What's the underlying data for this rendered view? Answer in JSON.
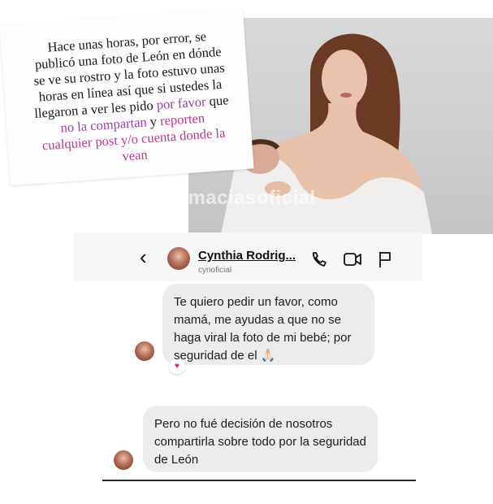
{
  "story": {
    "note_line1": "Hace unas horas, por error, se",
    "note_line2": "publicó una foto de León en dónde",
    "note_line3": "se ve su rostro y la foto estuvo unas",
    "note_line4": "horas en línea así que si ustedes la",
    "note_line5a": "llegaron a ver les pido ",
    "note_line5b": "por favor",
    "note_line5c": " que",
    "note_line6a": "no la compartan",
    "note_line6b": " y ",
    "note_line6c": "reporten",
    "note_line7": "cualquier post y/o cuenta donde la",
    "note_line8": "vean",
    "watermark": "@raymaciasoficial"
  },
  "dm": {
    "name": "Cynthia Rodrig...",
    "handle": "cynoficial",
    "message1": "Te quiero pedir un favor, como mamá, me ayudas a que no se haga viral la foto de mi bebé; por seguridad de el 🙏🏻",
    "message2": "Pero no fué decisión de nosotros compartirla sobre todo por la seguridad de León",
    "reaction": "♥"
  },
  "colors": {
    "purple": "#9b3fb0",
    "pink": "#c03590",
    "bubble": "#ececec"
  }
}
